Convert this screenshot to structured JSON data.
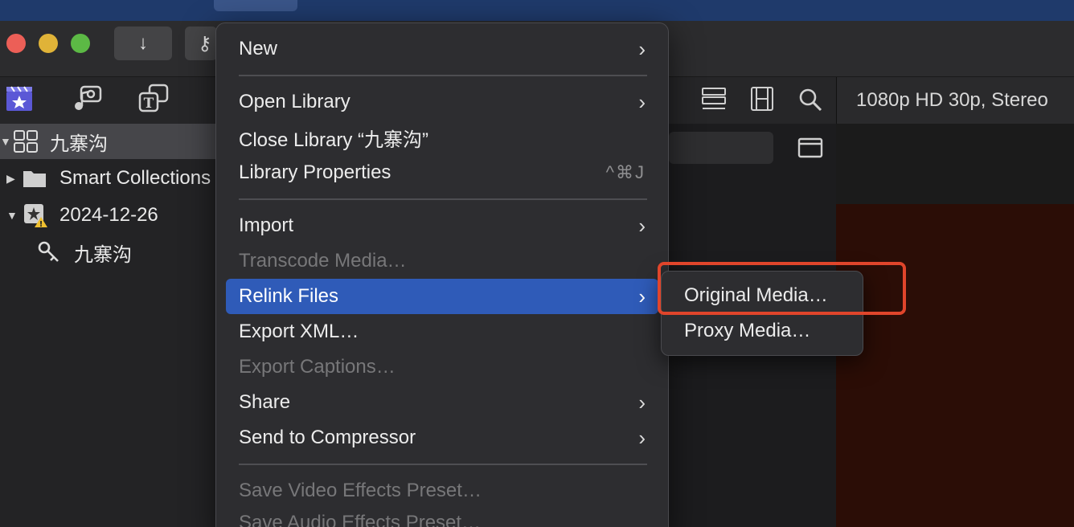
{
  "viewer": {
    "format_label": "1080p HD 30p, Stereo"
  },
  "toolbar": {
    "import_icon": "download-arrow-icon",
    "keyword_icon": "key-icon"
  },
  "browser_tabs": [
    {
      "name": "libraries-icon"
    },
    {
      "name": "photos-audio-icon"
    },
    {
      "name": "titles-generators-icon"
    }
  ],
  "sidebar": {
    "library": "九寨沟",
    "items": [
      {
        "label": "Smart Collections"
      },
      {
        "label": "2024-12-26"
      },
      {
        "label": "九寨沟"
      }
    ]
  },
  "file_menu": {
    "items": [
      {
        "label": "New",
        "submenu": true
      },
      {
        "label": "Open Library",
        "submenu": true
      },
      {
        "label": "Close Library “九寨沟”"
      },
      {
        "label": "Library Properties",
        "shortcut": "^⌘J"
      },
      {
        "label": "Import",
        "submenu": true
      },
      {
        "label": "Transcode Media…",
        "disabled": true
      },
      {
        "label": "Relink Files",
        "submenu": true,
        "highlighted": true
      },
      {
        "label": "Export XML…"
      },
      {
        "label": "Export Captions…",
        "disabled": true
      },
      {
        "label": "Share",
        "submenu": true
      },
      {
        "label": "Send to Compressor",
        "submenu": true
      },
      {
        "label": "Save Video Effects Preset…",
        "disabled": true
      },
      {
        "label": "Save Audio Effects Preset…",
        "disabled": true
      }
    ]
  },
  "relink_submenu": {
    "items": [
      {
        "label": "Original Media…"
      },
      {
        "label": "Proxy Media…"
      }
    ]
  },
  "colors": {
    "highlight": "#2f5bb8",
    "annotation": "#e0452b",
    "viewer_frame": "#2b0d06"
  }
}
